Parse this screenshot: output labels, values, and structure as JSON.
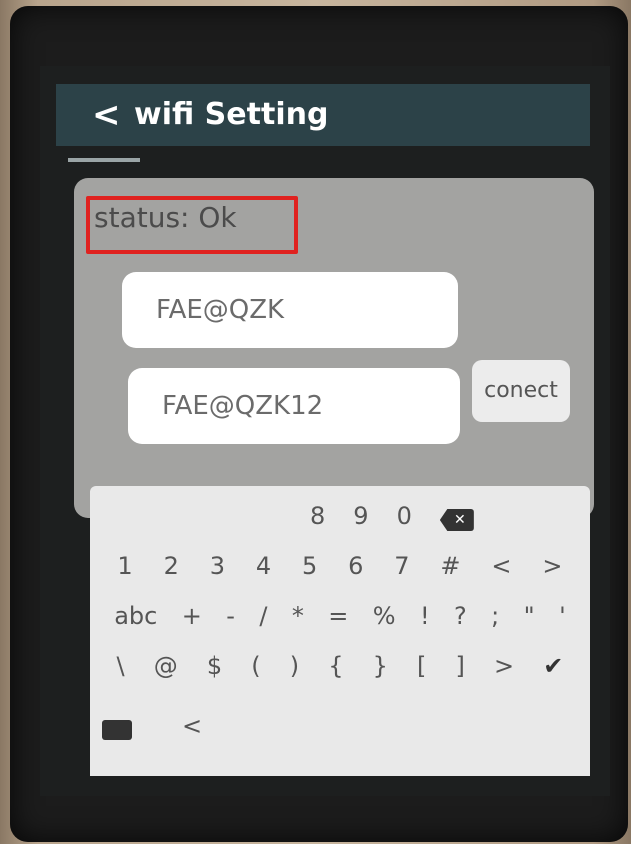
{
  "header": {
    "back_glyph": "<",
    "title": "wifi Setting"
  },
  "status": {
    "text": "status: Ok"
  },
  "ssid_field": {
    "value": "FAE@QZK"
  },
  "password_field": {
    "value": "FAE@QZK12"
  },
  "connect_button": {
    "label": "conect"
  },
  "keyboard": {
    "row1": [
      "8",
      "9",
      "0"
    ],
    "row2": [
      "1",
      "2",
      "3",
      "4",
      "5",
      "6",
      "7",
      "#",
      "<",
      ">"
    ],
    "row3": [
      "abc",
      "+",
      "-",
      "/",
      "*",
      "=",
      "%",
      "!",
      "?",
      ";",
      "\"",
      "'"
    ],
    "row4": [
      "\\",
      "@",
      "$",
      "(",
      ")",
      "{",
      "}",
      "[",
      "]",
      ">",
      "✔"
    ],
    "row5": [
      "<"
    ],
    "backspace_icon": "backspace-icon",
    "keyboard_icon": "keyboard-icon",
    "ok_icon": "checkmark-icon"
  }
}
